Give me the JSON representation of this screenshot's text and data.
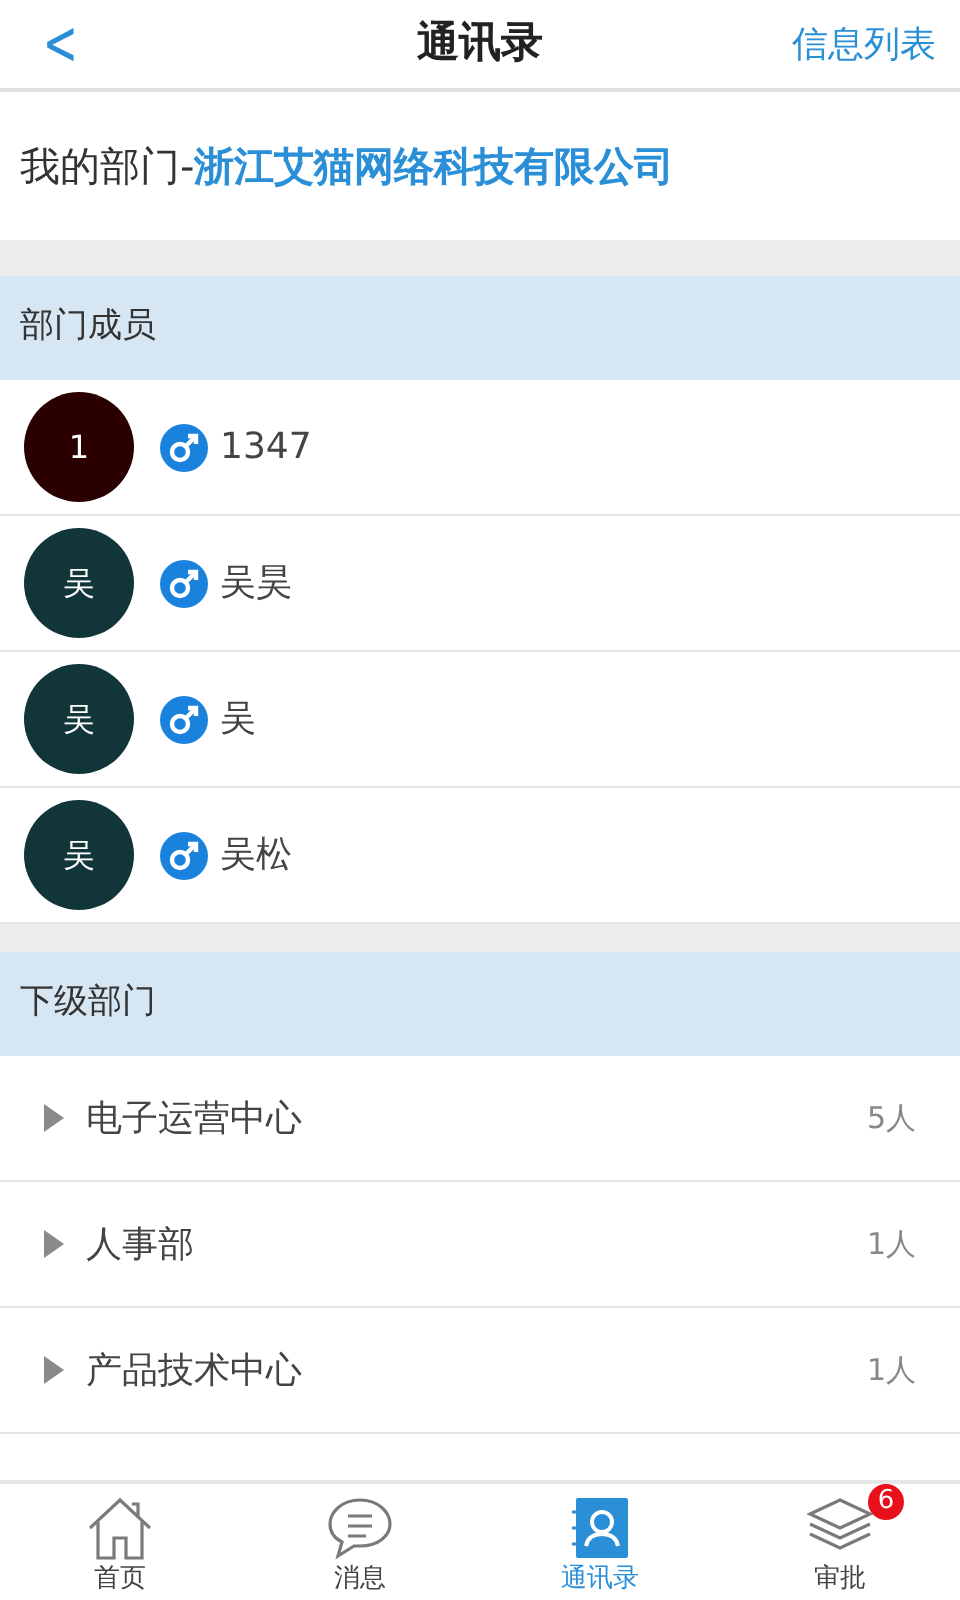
{
  "header": {
    "back": "<",
    "title": "通讯录",
    "action": "信息列表"
  },
  "department": {
    "label": "我的部门-",
    "name": "浙江艾猫网络科技有限公司"
  },
  "members_section": {
    "title": "部门成员"
  },
  "members": [
    {
      "avatar": "1",
      "color": "#2b0000",
      "male": true,
      "name": "1347"
    },
    {
      "avatar": "吴",
      "color": "#12353a",
      "male": true,
      "name": "吴昊"
    },
    {
      "avatar": "吴",
      "color": "#12353a",
      "male": true,
      "name": "吴"
    },
    {
      "avatar": "吴",
      "color": "#12353a",
      "male": true,
      "name": "吴松"
    }
  ],
  "subdepartments_section": {
    "title": "下级部门"
  },
  "subdepartments": [
    {
      "name": "电子运营中心",
      "count": "5人"
    },
    {
      "name": "人事部",
      "count": "1人"
    },
    {
      "name": "产品技术中心",
      "count": "1人"
    }
  ],
  "tabs": [
    {
      "kind": "home",
      "label": "首页",
      "selected": false
    },
    {
      "kind": "message",
      "label": "消息",
      "selected": false
    },
    {
      "kind": "contacts",
      "label": "通讯录",
      "selected": true
    },
    {
      "kind": "approval",
      "label": "审批",
      "selected": false,
      "badge": "6"
    }
  ]
}
